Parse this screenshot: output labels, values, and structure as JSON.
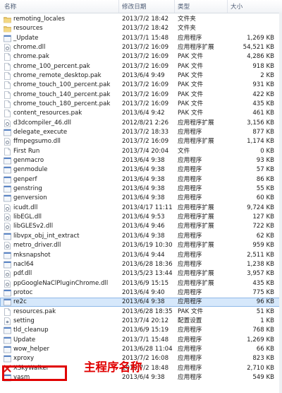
{
  "columns": {
    "name": "名称",
    "date": "修改日期",
    "type": "类型",
    "size": "大小"
  },
  "colors": {
    "selected_row": "#d6e8fb",
    "annotation": "#e00000",
    "folder": "#e8c560"
  },
  "files": [
    {
      "name": "remoting_locales",
      "date": "2013/7/2 18:42",
      "type": "文件夹",
      "size": "",
      "icon": "folder-icon"
    },
    {
      "name": "resources",
      "date": "2013/7/2 18:42",
      "type": "文件夹",
      "size": "",
      "icon": "folder-icon"
    },
    {
      "name": "_Update",
      "date": "2013/7/1 15:48",
      "type": "应用程序",
      "size": "1,269 KB",
      "icon": "app-icon"
    },
    {
      "name": "chrome.dll",
      "date": "2013/7/2 16:09",
      "type": "应用程序扩展",
      "size": "54,521 KB",
      "icon": "dll-icon"
    },
    {
      "name": "chrome.pak",
      "date": "2013/7/2 16:09",
      "type": "PAK 文件",
      "size": "4,286 KB",
      "icon": "file-icon"
    },
    {
      "name": "chrome_100_percent.pak",
      "date": "2013/7/2 16:09",
      "type": "PAK 文件",
      "size": "918 KB",
      "icon": "file-icon"
    },
    {
      "name": "chrome_remote_desktop.pak",
      "date": "2013/6/4 9:49",
      "type": "PAK 文件",
      "size": "2 KB",
      "icon": "file-icon"
    },
    {
      "name": "chrome_touch_100_percent.pak",
      "date": "2013/7/2 16:09",
      "type": "PAK 文件",
      "size": "931 KB",
      "icon": "file-icon"
    },
    {
      "name": "chrome_touch_140_percent.pak",
      "date": "2013/7/2 16:09",
      "type": "PAK 文件",
      "size": "422 KB",
      "icon": "file-icon"
    },
    {
      "name": "chrome_touch_180_percent.pak",
      "date": "2013/7/2 16:09",
      "type": "PAK 文件",
      "size": "435 KB",
      "icon": "file-icon"
    },
    {
      "name": "content_resources.pak",
      "date": "2013/6/4 9:42",
      "type": "PAK 文件",
      "size": "461 KB",
      "icon": "file-icon"
    },
    {
      "name": "d3dcompiler_46.dll",
      "date": "2012/8/21 2:26",
      "type": "应用程序扩展",
      "size": "3,156 KB",
      "icon": "dll-icon"
    },
    {
      "name": "delegate_execute",
      "date": "2013/7/2 18:33",
      "type": "应用程序",
      "size": "877 KB",
      "icon": "app-icon"
    },
    {
      "name": "ffmpegsumo.dll",
      "date": "2013/7/2 16:09",
      "type": "应用程序扩展",
      "size": "1,174 KB",
      "icon": "dll-icon"
    },
    {
      "name": "First Run",
      "date": "2013/7/4 20:04",
      "type": "文件",
      "size": "0 KB",
      "icon": "file-icon"
    },
    {
      "name": "genmacro",
      "date": "2013/6/4 9:38",
      "type": "应用程序",
      "size": "93 KB",
      "icon": "app-icon"
    },
    {
      "name": "genmodule",
      "date": "2013/6/4 9:38",
      "type": "应用程序",
      "size": "57 KB",
      "icon": "app-icon"
    },
    {
      "name": "genperf",
      "date": "2013/6/4 9:38",
      "type": "应用程序",
      "size": "86 KB",
      "icon": "app-icon"
    },
    {
      "name": "genstring",
      "date": "2013/6/4 9:38",
      "type": "应用程序",
      "size": "55 KB",
      "icon": "app-icon"
    },
    {
      "name": "genversion",
      "date": "2013/6/4 9:38",
      "type": "应用程序",
      "size": "60 KB",
      "icon": "app-icon"
    },
    {
      "name": "icudt.dll",
      "date": "2013/4/17 11:11",
      "type": "应用程序扩展",
      "size": "9,724 KB",
      "icon": "dll-icon"
    },
    {
      "name": "libEGL.dll",
      "date": "2013/6/4 9:53",
      "type": "应用程序扩展",
      "size": "127 KB",
      "icon": "dll-icon"
    },
    {
      "name": "libGLESv2.dll",
      "date": "2013/6/4 9:46",
      "type": "应用程序扩展",
      "size": "722 KB",
      "icon": "dll-icon"
    },
    {
      "name": "libvpx_obj_int_extract",
      "date": "2013/6/4 9:38",
      "type": "应用程序",
      "size": "62 KB",
      "icon": "app-icon"
    },
    {
      "name": "metro_driver.dll",
      "date": "2013/6/19 10:30",
      "type": "应用程序扩展",
      "size": "959 KB",
      "icon": "dll-icon"
    },
    {
      "name": "mksnapshot",
      "date": "2013/6/4 9:44",
      "type": "应用程序",
      "size": "2,511 KB",
      "icon": "app-icon"
    },
    {
      "name": "nacl64",
      "date": "2013/6/28 18:36",
      "type": "应用程序",
      "size": "1,238 KB",
      "icon": "app-icon"
    },
    {
      "name": "pdf.dll",
      "date": "2013/5/23 13:44",
      "type": "应用程序扩展",
      "size": "3,957 KB",
      "icon": "dll-icon"
    },
    {
      "name": "ppGoogleNaClPluginChrome.dll",
      "date": "2013/6/9 15:15",
      "type": "应用程序扩展",
      "size": "435 KB",
      "icon": "dll-icon"
    },
    {
      "name": "protoc",
      "date": "2013/6/4 9:40",
      "type": "应用程序",
      "size": "775 KB",
      "icon": "app-icon"
    },
    {
      "name": "re2c",
      "date": "2013/6/4 9:38",
      "type": "应用程序",
      "size": "96 KB",
      "icon": "app-icon",
      "selected": true
    },
    {
      "name": "resources.pak",
      "date": "2013/6/28 18:35",
      "type": "PAK 文件",
      "size": "51 KB",
      "icon": "file-icon"
    },
    {
      "name": "setting",
      "date": "2013/7/4 20:12",
      "type": "配置设置",
      "size": "1 KB",
      "icon": "settings-file-icon"
    },
    {
      "name": "tld_cleanup",
      "date": "2013/6/9 15:19",
      "type": "应用程序",
      "size": "768 KB",
      "icon": "app-icon"
    },
    {
      "name": "Update",
      "date": "2013/7/1 15:48",
      "type": "应用程序",
      "size": "1,269 KB",
      "icon": "app-icon"
    },
    {
      "name": "wow_helper",
      "date": "2013/6/28 11:04",
      "type": "应用程序",
      "size": "66 KB",
      "icon": "app-icon"
    },
    {
      "name": "xproxy",
      "date": "2013/7/2 16:08",
      "type": "应用程序",
      "size": "823 KB",
      "icon": "app-icon"
    },
    {
      "name": "XSkyWalker",
      "date": "2013/7/2 18:48",
      "type": "应用程序",
      "size": "2,710 KB",
      "icon": "xsky-icon"
    },
    {
      "name": "yasm",
      "date": "2013/6/4 9:38",
      "type": "应用程序",
      "size": "549 KB",
      "icon": "app-icon"
    }
  ],
  "annotation": {
    "label": "主程序名称"
  }
}
